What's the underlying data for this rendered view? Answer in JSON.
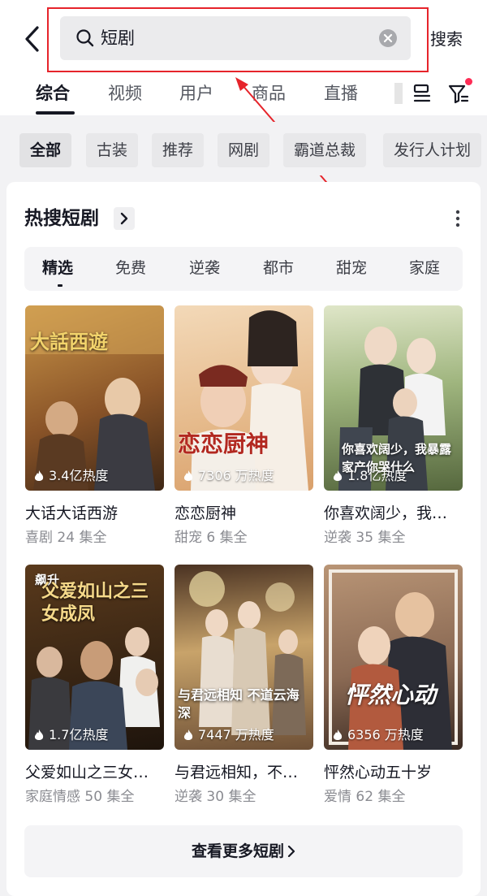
{
  "search": {
    "query": "短剧",
    "button_label": "搜索"
  },
  "tabs": [
    {
      "label": "综合",
      "active": true
    },
    {
      "label": "视频"
    },
    {
      "label": "用户"
    },
    {
      "label": "商品"
    },
    {
      "label": "直播"
    }
  ],
  "chips": [
    {
      "label": "全部",
      "active": true
    },
    {
      "label": "古装"
    },
    {
      "label": "推荐"
    },
    {
      "label": "网剧"
    },
    {
      "label": "霸道总裁"
    },
    {
      "label": "发行人计划"
    }
  ],
  "section": {
    "title": "热搜短剧",
    "subtabs": [
      {
        "label": "精选",
        "active": true
      },
      {
        "label": "免费"
      },
      {
        "label": "逆袭"
      },
      {
        "label": "都市"
      },
      {
        "label": "甜宠"
      },
      {
        "label": "家庭"
      }
    ],
    "dramas": [
      {
        "title": "大话大话西游",
        "heat": "3.4亿热度",
        "genre": "喜剧",
        "episodes": "24 集全",
        "poster_caption": "大話西遊"
      },
      {
        "title": "恋恋厨神",
        "heat": "7306 万热度",
        "genre": "甜宠",
        "episodes": "6 集全",
        "poster_caption": "恋恋厨神"
      },
      {
        "title": "你喜欢阔少，我…",
        "heat": "1.8亿热度",
        "genre": "逆袭",
        "episodes": "35 集全",
        "poster_caption": "你喜欢阔少，我暴露家产你哭什么"
      },
      {
        "title": "父爱如山之三女…",
        "heat": "1.7亿热度",
        "genre": "家庭情感",
        "episodes": "50 集全",
        "poster_caption": "父爱如山之三女成凤",
        "badge": "飙升"
      },
      {
        "title": "与君远相知，不…",
        "heat": "7447 万热度",
        "genre": "逆袭",
        "episodes": "30 集全",
        "poster_caption": "与君远相知 不道云海深"
      },
      {
        "title": "怦然心动五十岁",
        "heat": "6356 万热度",
        "genre": "爱情",
        "episodes": "62 集全",
        "poster_caption": "怦然心动"
      }
    ],
    "more_label": "查看更多短剧"
  },
  "colors": {
    "highlight": "#e6242b",
    "accent_dot": "#fe2c55",
    "text_primary": "#161823",
    "text_secondary": "#8a8b91"
  }
}
